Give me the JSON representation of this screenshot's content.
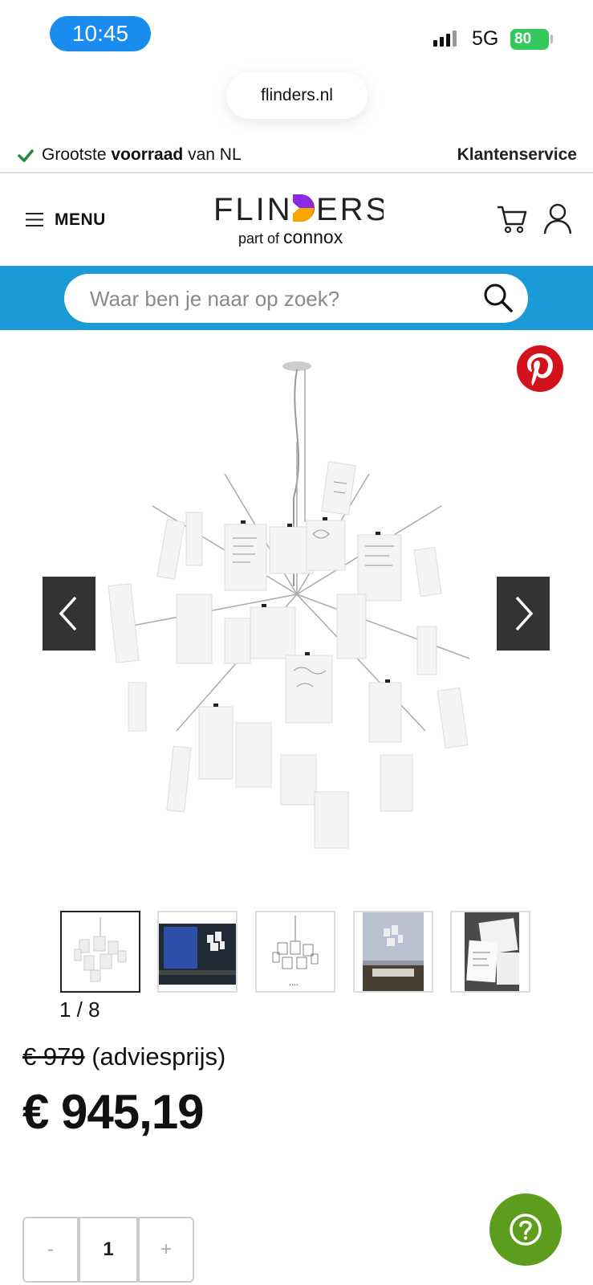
{
  "status_bar": {
    "time": "10:45",
    "network": "5G",
    "battery": "80"
  },
  "browser": {
    "url": "flinders.nl"
  },
  "promo": {
    "prefix": "Grootste ",
    "bold": "voorraad",
    "suffix": " van NL",
    "service_link": "Klantenservice"
  },
  "header": {
    "menu_label": "MENU",
    "logo_text": "FLINDERS",
    "logo_sub_prefix": "part of",
    "logo_sub_brand": "connox"
  },
  "search": {
    "placeholder": "Waar ben je naar op zoek?"
  },
  "gallery": {
    "counter": "1 / 8",
    "thumbnails": [
      "thumb-1",
      "thumb-2",
      "thumb-3",
      "thumb-4",
      "thumb-5"
    ],
    "active_index": 0
  },
  "price": {
    "old": "€ 979",
    "old_note": "(adviesprijs)",
    "current": "€ 945,19"
  },
  "quantity": {
    "minus": "-",
    "value": "1",
    "plus": "+"
  },
  "colors": {
    "search_band": "#1a9bd7",
    "help_button": "#5c9d1d",
    "pinterest": "#d3121b",
    "time_pill": "#1a8cf0"
  }
}
